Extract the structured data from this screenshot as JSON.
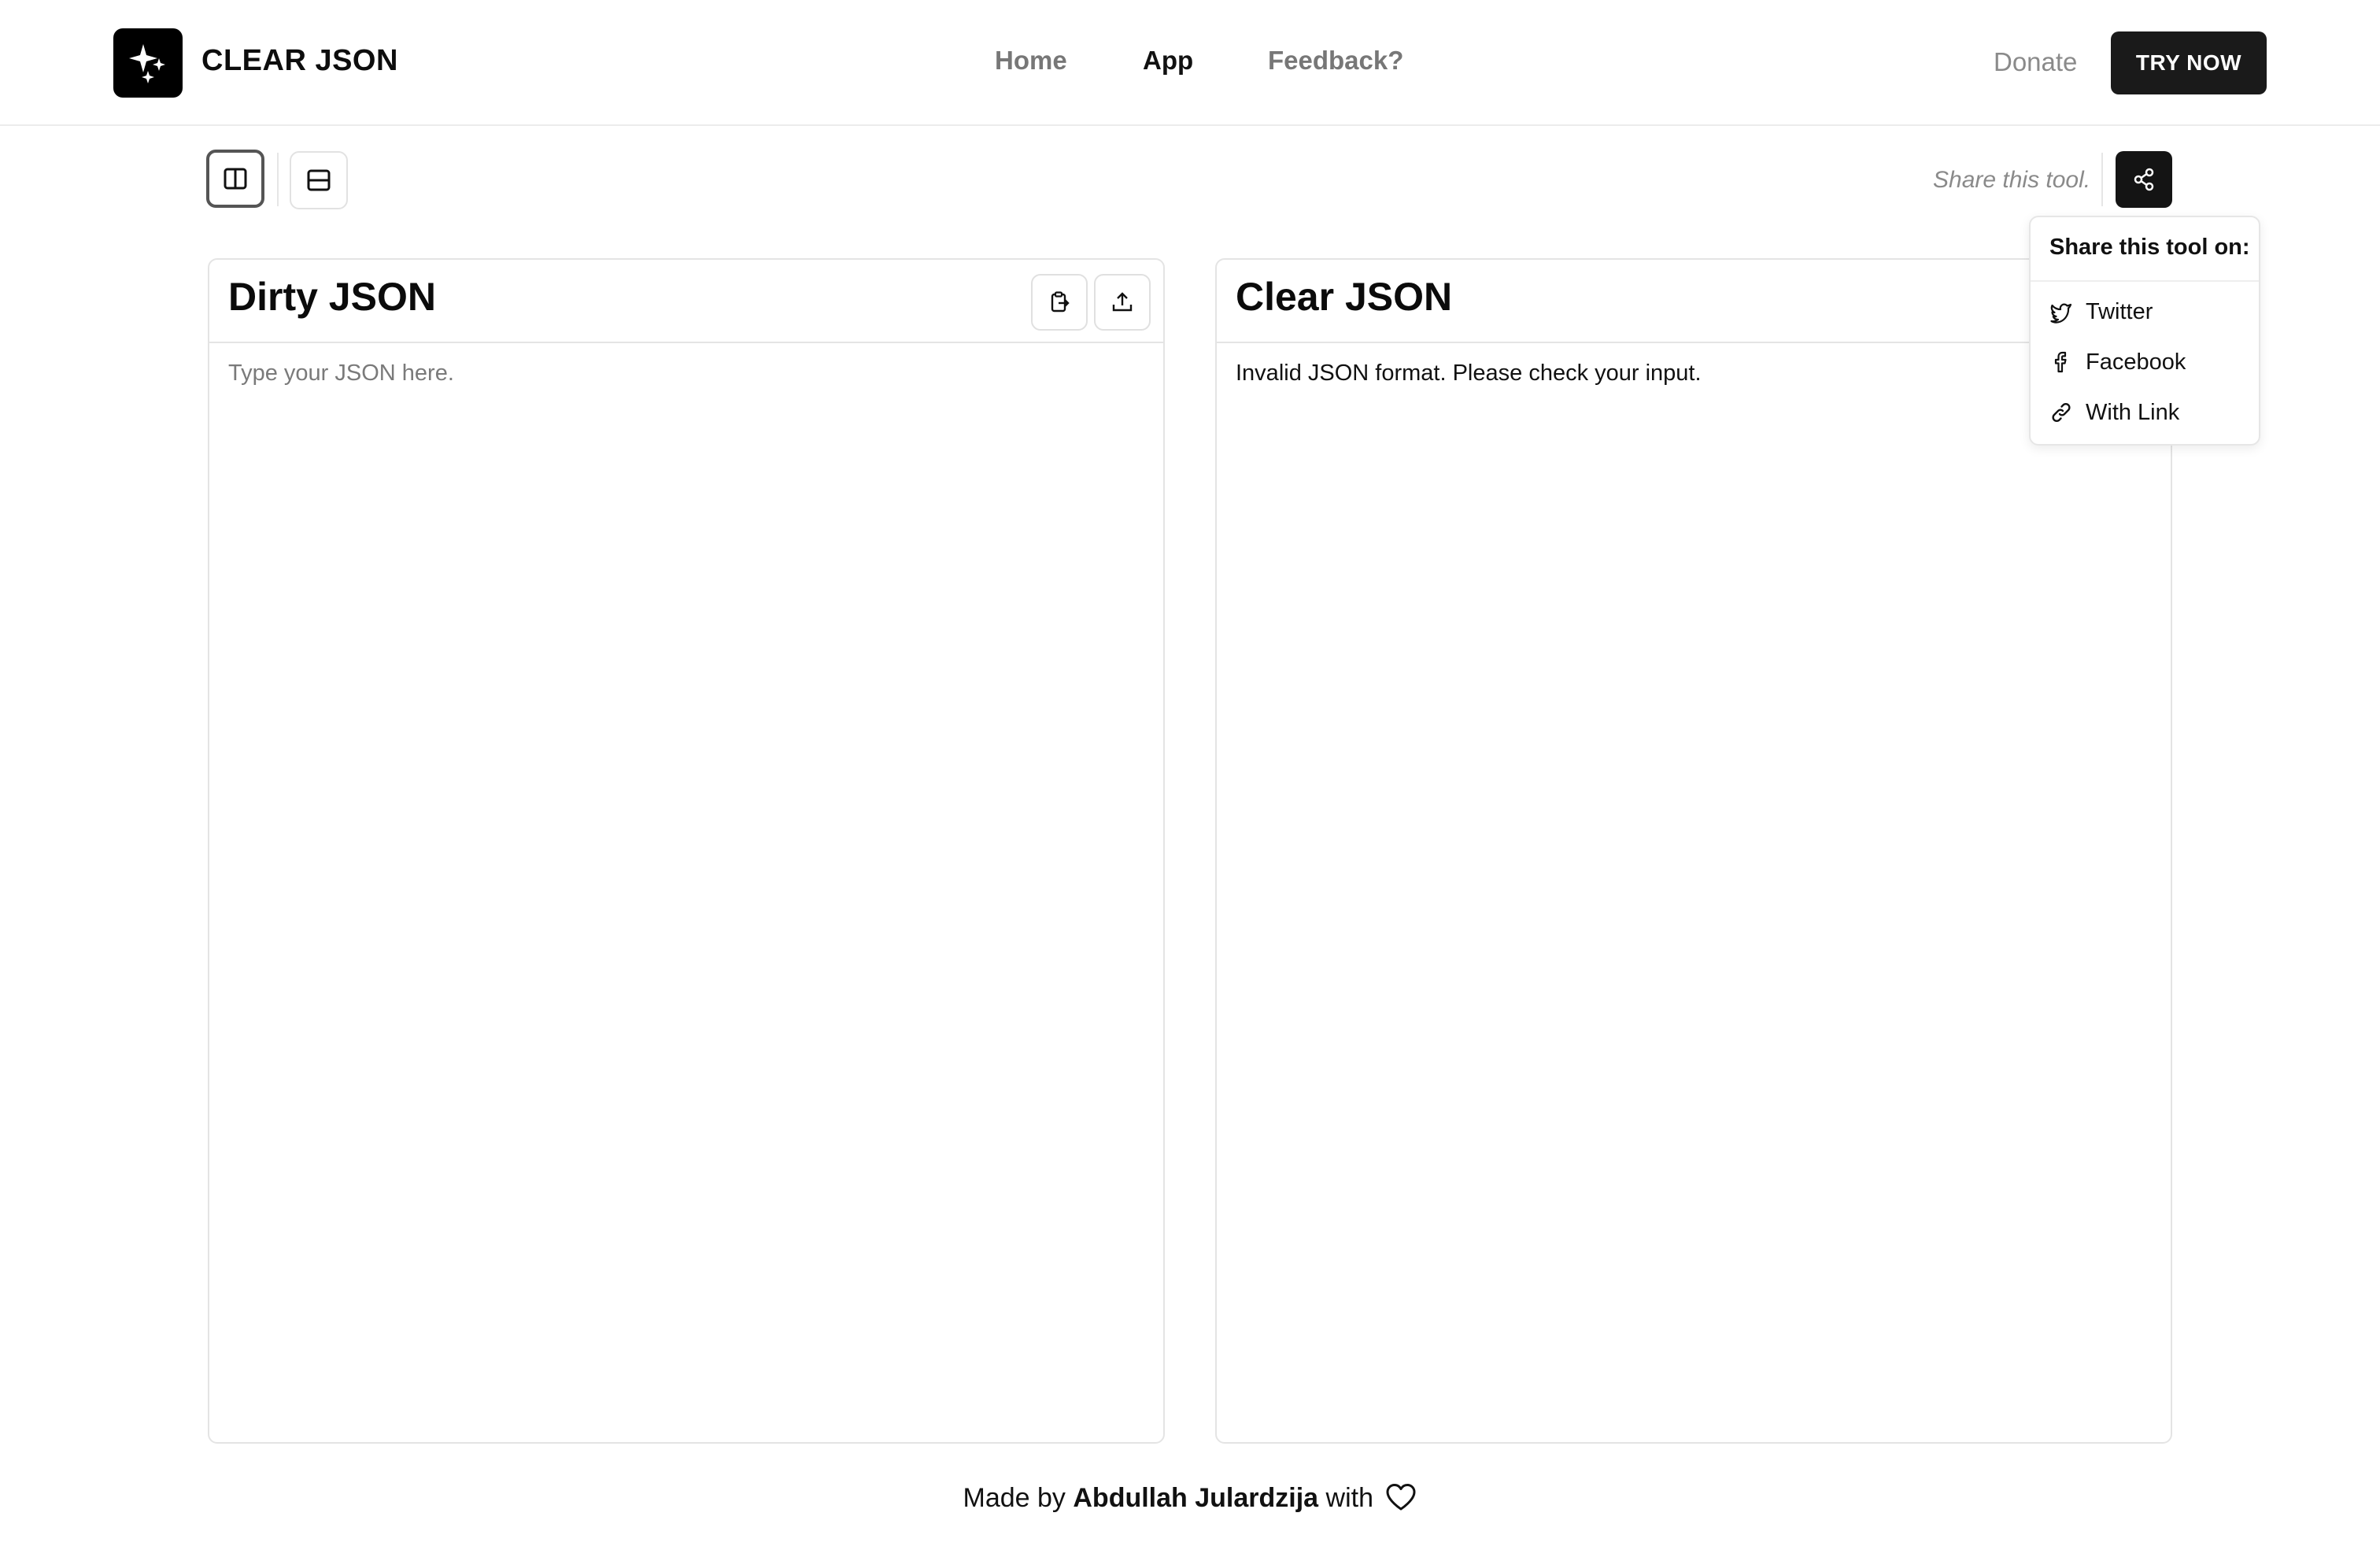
{
  "brand": {
    "name": "CLEAR JSON",
    "logo_icon": "sparkles-icon"
  },
  "nav": {
    "items": [
      {
        "label": "Home",
        "active": false
      },
      {
        "label": "App",
        "active": true
      },
      {
        "label": "Feedback?",
        "active": false
      }
    ],
    "donate_label": "Donate",
    "cta_label": "TRY NOW"
  },
  "toolbar": {
    "layout_buttons": [
      {
        "icon": "columns-layout-icon",
        "active": true
      },
      {
        "icon": "rows-layout-icon",
        "active": false
      }
    ],
    "share_text": "Share this tool.",
    "share_icon": "share-icon"
  },
  "share_menu": {
    "title": "Share this tool on:",
    "items": [
      {
        "label": "Twitter",
        "icon": "twitter-icon"
      },
      {
        "label": "Facebook",
        "icon": "facebook-icon"
      },
      {
        "label": "With Link",
        "icon": "link-icon"
      }
    ]
  },
  "input_panel": {
    "title": "Dirty JSON",
    "placeholder": "Type your JSON here.",
    "value": "",
    "actions": [
      {
        "icon": "paste-clipboard-icon"
      },
      {
        "icon": "upload-icon"
      }
    ]
  },
  "output_panel": {
    "title": "Clear JSON",
    "result": "Invalid JSON format. Please check your input."
  },
  "footer": {
    "prefix": "Made by",
    "author": "Abdullah Julardzija",
    "suffix": "with",
    "icon": "heart-icon"
  },
  "colors": {
    "primary_dark": "#1a1a1a",
    "muted_text": "#777777",
    "border": "#e4e4e4"
  }
}
